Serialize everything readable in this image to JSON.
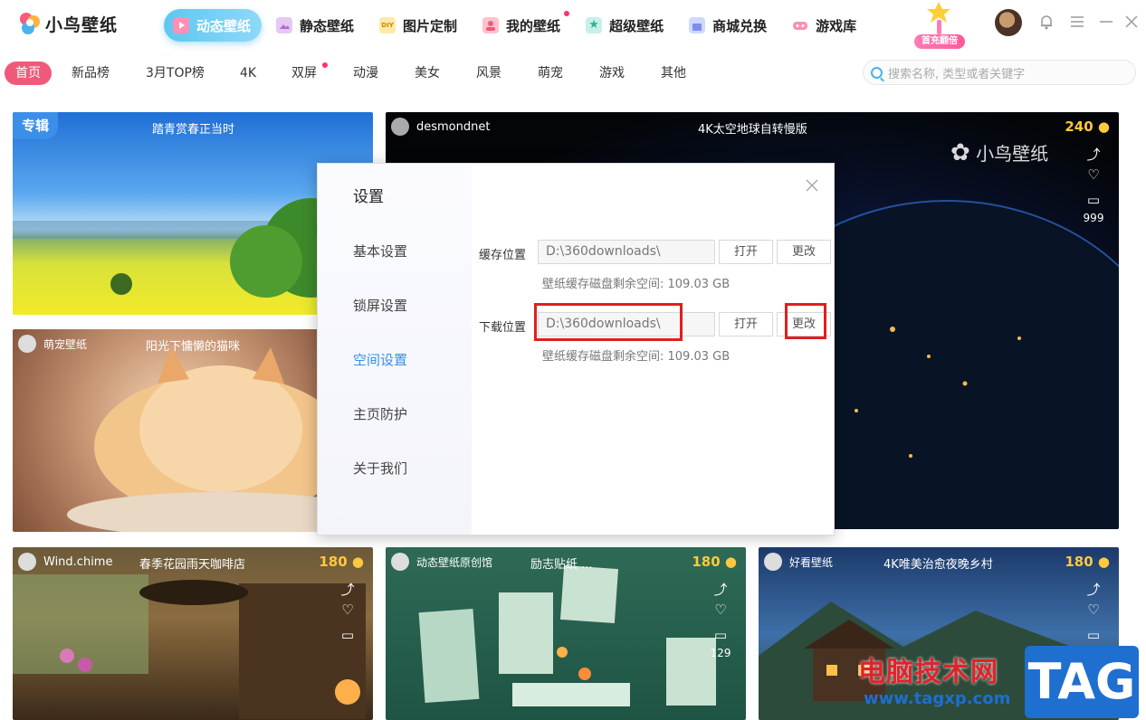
{
  "app": {
    "title": "小鸟壁纸"
  },
  "nav": [
    {
      "label": "动态壁纸",
      "active": true
    },
    {
      "label": "静态壁纸"
    },
    {
      "label": "图片定制"
    },
    {
      "label": "我的壁纸",
      "dot": true
    },
    {
      "label": "超级壁纸"
    },
    {
      "label": "商城兑换"
    },
    {
      "label": "游戏库"
    }
  ],
  "promo": {
    "badge": "首充翻倍"
  },
  "categories": [
    {
      "label": "首页",
      "active": true
    },
    {
      "label": "新品榜"
    },
    {
      "label": "3月TOP榜"
    },
    {
      "label": "4K"
    },
    {
      "label": "双屏",
      "dot": true
    },
    {
      "label": "动漫"
    },
    {
      "label": "美女"
    },
    {
      "label": "风景"
    },
    {
      "label": "萌宠"
    },
    {
      "label": "游戏"
    },
    {
      "label": "其他"
    }
  ],
  "search": {
    "placeholder": "搜索名称, 类型或者关键字"
  },
  "cards": {
    "spring": {
      "tag": "专辑",
      "title": "踏青赏春正当时"
    },
    "earth": {
      "author": "desmondnet",
      "title": "4K太空地球自转慢版",
      "price": "240",
      "comments": "999",
      "brand": "小鸟壁纸"
    },
    "cat": {
      "author": "萌宠壁纸",
      "title": "阳光下慵懒的猫咪"
    },
    "cafe": {
      "author": "Wind.chime",
      "title": "春季花园雨天咖啡店",
      "price": "180"
    },
    "quotes": {
      "author": "动态壁纸原创馆",
      "title": "励志贴纸 ...",
      "price": "180",
      "comments": "129"
    },
    "village": {
      "author": "好看壁纸",
      "title": "4K唯美治愈夜晚乡村",
      "price": "180"
    }
  },
  "dialog": {
    "title": "设置",
    "menu": [
      "基本设置",
      "锁屏设置",
      "空间设置",
      "主页防护",
      "关于我们"
    ],
    "active_menu": "空间设置",
    "cache": {
      "label": "缓存位置",
      "path": "D:\\360downloads\\",
      "open": "打开",
      "change": "更改",
      "hint": "壁纸缓存磁盘剩余空间: 109.03 GB"
    },
    "download": {
      "label": "下载位置",
      "path": "D:\\360downloads\\",
      "open": "打开",
      "change": "更改",
      "hint": "壁纸缓存磁盘剩余空间: 109.03 GB"
    }
  },
  "watermark": {
    "text": "电脑技术网",
    "url": "www.tagxp.com",
    "tag": "TAG"
  }
}
